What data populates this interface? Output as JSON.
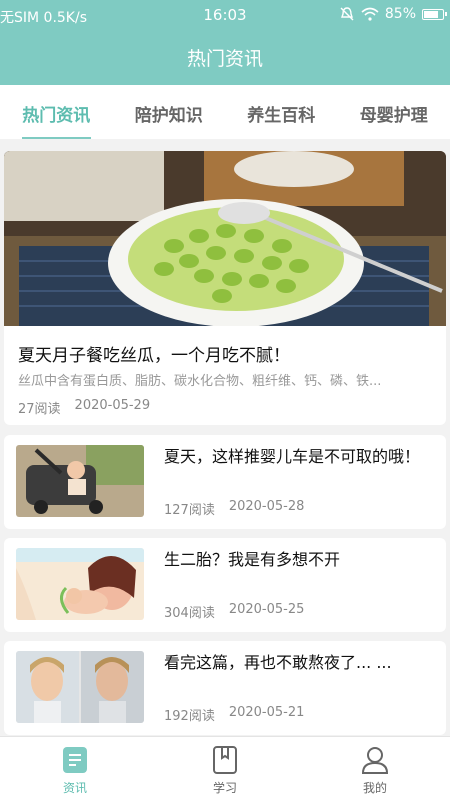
{
  "status_bar": {
    "carrier": "无SIM 0.5K/s",
    "time": "16:03",
    "battery": "85%",
    "battery_level": 0.85
  },
  "header": {
    "title": "热门资讯"
  },
  "tabs": [
    {
      "label": "热门资讯",
      "active": true
    },
    {
      "label": "陪护知识",
      "active": false
    },
    {
      "label": "养生百科",
      "active": false
    },
    {
      "label": "母婴护理",
      "active": false
    }
  ],
  "featured": {
    "title": "夏天月子餐吃丝瓜，一个月吃不腻！",
    "summary": "丝瓜中含有蛋白质、脂肪、碳水化合物、粗纤维、钙、磷、铁...",
    "reads": "27阅读",
    "date": "2020-05-29"
  },
  "articles": [
    {
      "title": "夏天，这样推婴儿车是不可取的哦！",
      "reads": "127阅读",
      "date": "2020-05-28"
    },
    {
      "title": "生二胎？我是有多想不开",
      "reads": "304阅读",
      "date": "2020-05-25"
    },
    {
      "title": "看完这篇，再也不敢熬夜了... ...",
      "reads": "192阅读",
      "date": "2020-05-21"
    }
  ],
  "bottom_nav": [
    {
      "label": "资讯",
      "icon": "news-icon",
      "active": true
    },
    {
      "label": "学习",
      "icon": "book-icon",
      "active": false
    },
    {
      "label": "我的",
      "icon": "user-icon",
      "active": false
    }
  ],
  "colors": {
    "accent": "#7fcbc2",
    "active_text": "#5dbcaf"
  }
}
